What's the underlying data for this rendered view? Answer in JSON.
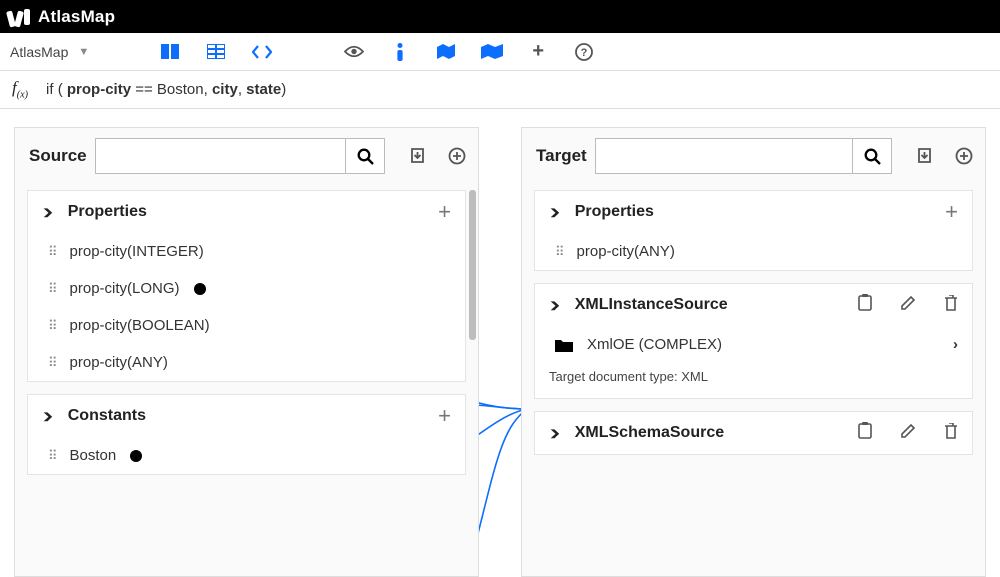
{
  "brand": {
    "name": "AtlasMap"
  },
  "breadcrumb": {
    "label": "AtlasMap"
  },
  "toolbar_icons": {
    "columns": "columns-icon",
    "table": "table-icon",
    "code": "code-icon",
    "eye": "eye-icon",
    "info": "info-icon",
    "map": "map-small-icon",
    "map_wide": "map-wide-icon",
    "plus": "plus-icon",
    "help": "help-icon"
  },
  "expression": {
    "prefix": "if ( ",
    "arg1": "prop-city",
    "op": " == ",
    "arg2": "Boston",
    "sep1": ", ",
    "arg3": "city",
    "sep2": ", ",
    "arg4": "state",
    "suffix": ")"
  },
  "source": {
    "title": "Source",
    "search_placeholder": "",
    "sections": {
      "properties": {
        "title": "Properties",
        "items": [
          {
            "label": "prop-city(INTEGER)",
            "dot": false
          },
          {
            "label": "prop-city(LONG)",
            "dot": true
          },
          {
            "label": "prop-city(BOOLEAN)",
            "dot": false
          },
          {
            "label": "prop-city(ANY)",
            "dot": false
          }
        ]
      },
      "constants": {
        "title": "Constants",
        "items": [
          {
            "label": "Boston",
            "dot": true
          }
        ]
      }
    }
  },
  "target": {
    "title": "Target",
    "search_placeholder": "",
    "sections": {
      "properties": {
        "title": "Properties",
        "items": [
          {
            "label": "prop-city(ANY)"
          }
        ]
      },
      "xml_instance": {
        "title": "XMLInstanceSource",
        "item_label": "XmlOE (COMPLEX)",
        "meta": "Target document type: XML"
      },
      "xml_schema": {
        "title": "XMLSchemaSource"
      }
    }
  }
}
